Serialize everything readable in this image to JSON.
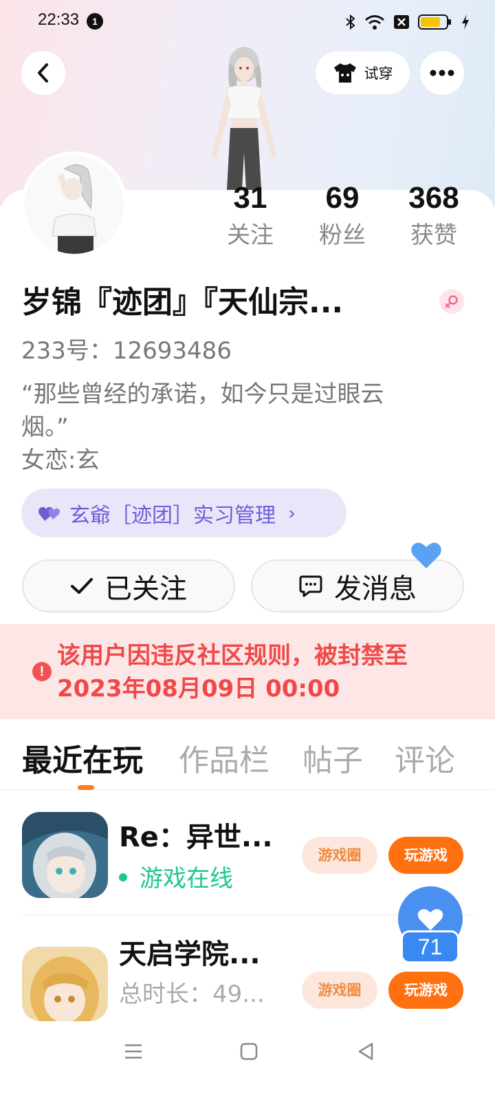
{
  "status_bar": {
    "time": "22:33",
    "notification_count": "1",
    "battery_color": "#f5c400"
  },
  "header": {
    "back_icon": "chevron-left-icon",
    "try_on_label": "试穿",
    "more_icon": "more-horizontal-icon"
  },
  "stats": [
    {
      "value": "31",
      "label": "关注"
    },
    {
      "value": "69",
      "label": "粉丝"
    },
    {
      "value": "368",
      "label": "获赞"
    }
  ],
  "profile": {
    "name": "岁锦『迹团』『天仙宗...",
    "gender_icon": "female-icon",
    "uid": "233号：12693486",
    "bio": "“那些曾经的承诺，如今只是过眼云\n烟。”\n女恋:玄",
    "title_chip": "玄爺［迹团］实习管理"
  },
  "actions": {
    "follow_label": "已关注",
    "message_label": "发消息"
  },
  "ban_notice": {
    "text": "该用户因违反社区规则，被封禁至2023年08月09日 00:00",
    "color": "#f04848"
  },
  "tabs": [
    {
      "label": "最近在玩",
      "active": true
    },
    {
      "label": "作品栏",
      "active": false
    },
    {
      "label": "帖子",
      "active": false
    },
    {
      "label": "评论",
      "active": false
    }
  ],
  "games": [
    {
      "title": "Re：异世...",
      "status": "游戏在线",
      "circle_label": "游戏圈",
      "play_label": "玩游戏"
    },
    {
      "title": "天启学院...",
      "status": "总时长：49...",
      "circle_label": "游戏圈",
      "play_label": "玩游戏"
    }
  ],
  "like_float": {
    "count": "71"
  },
  "accent_color": "#ff7010"
}
